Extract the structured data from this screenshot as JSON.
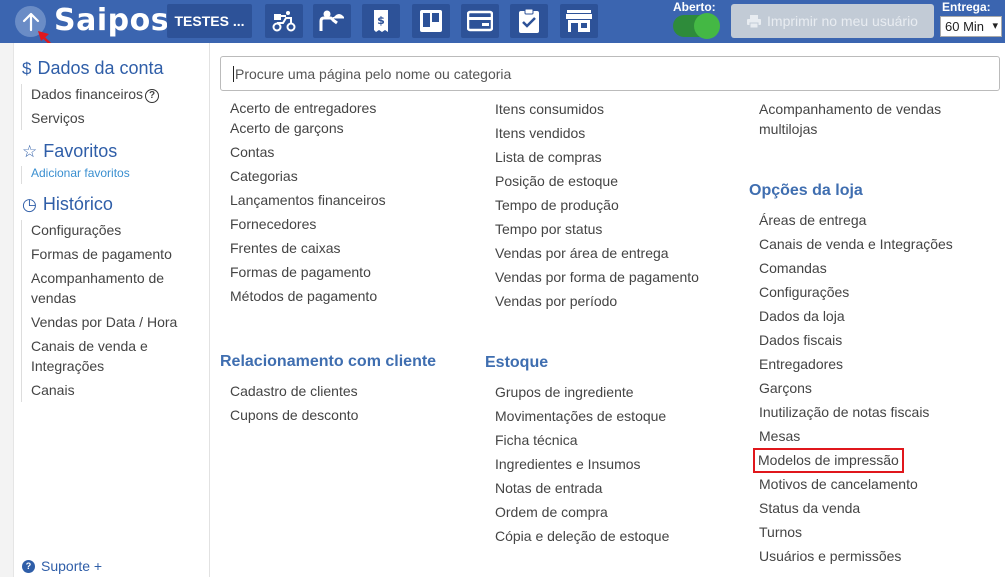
{
  "topbar": {
    "logo": "Saipos",
    "store_name": "TESTES ...",
    "nav_icons": [
      "delivery-icon",
      "waiter-icon",
      "receipt-icon",
      "kanban-icon",
      "card-icon",
      "checklist-icon",
      "store-icon"
    ],
    "aberto_label": "Aberto:",
    "aberto_on": true,
    "print_button": "Imprimir no meu usuário",
    "entrega_label": "Entrega:",
    "entrega_value": "60 Min"
  },
  "sidebar": {
    "account": {
      "heading": "Dados da conta",
      "items": [
        "Dados financeiros",
        "Serviços"
      ]
    },
    "favorites": {
      "heading": "Favoritos",
      "add_link": "Adicionar favoritos"
    },
    "history": {
      "heading": "Histórico",
      "items": [
        "Configurações",
        "Formas de pagamento",
        "Acompanhamento de",
        "vendas",
        "Vendas por Data / Hora",
        "Canais de venda e",
        "Integrações",
        "Canais"
      ]
    },
    "support": "Suporte +"
  },
  "search": {
    "placeholder": "Procure uma página pelo nome ou categoria"
  },
  "columns": {
    "col1": {
      "items": [
        "Acerto de entregadores",
        "Acerto de garçons",
        "Contas",
        "Categorias",
        "Lançamentos financeiros",
        "Fornecedores",
        "Frentes de caixas",
        "Formas de pagamento",
        "Métodos de pagamento"
      ],
      "relacionamento_heading": "Relacionamento com cliente",
      "relacionamento_items": [
        "Cadastro de clientes",
        "Cupons de desconto"
      ]
    },
    "col2": {
      "items": [
        "Itens consumidos",
        "Itens vendidos",
        "Lista de compras",
        "Posição de estoque",
        "Tempo de produção",
        "Tempo por status",
        "Vendas por área de entrega",
        "Vendas por forma de pagamento",
        "Vendas por período"
      ],
      "estoque_heading": "Estoque",
      "estoque_items": [
        "Grupos de ingrediente",
        "Movimentações de estoque",
        "Ficha técnica",
        "Ingredientes e Insumos",
        "Notas de entrada",
        "Ordem de compra",
        "Cópia e deleção de estoque"
      ]
    },
    "col3": {
      "top_items": [
        "Acompanhamento de vendas",
        "multilojas"
      ],
      "opcoes_heading": "Opções da loja",
      "opcoes_items": [
        "Áreas de entrega",
        "Canais de venda e Integrações",
        "Comandas",
        "Configurações",
        "Dados da loja",
        "Dados fiscais",
        "Entregadores",
        "Garçons",
        "Inutilização de notas fiscais",
        "Mesas",
        "Modelos de impressão",
        "Motivos de cancelamento",
        "Status da venda",
        "Turnos",
        "Usuários e permissões"
      ]
    }
  },
  "colors": {
    "topbar": "#3b65b0",
    "heading": "#3f6eb0",
    "highlight": "#e0171c",
    "toggle_on": "#44b844"
  }
}
